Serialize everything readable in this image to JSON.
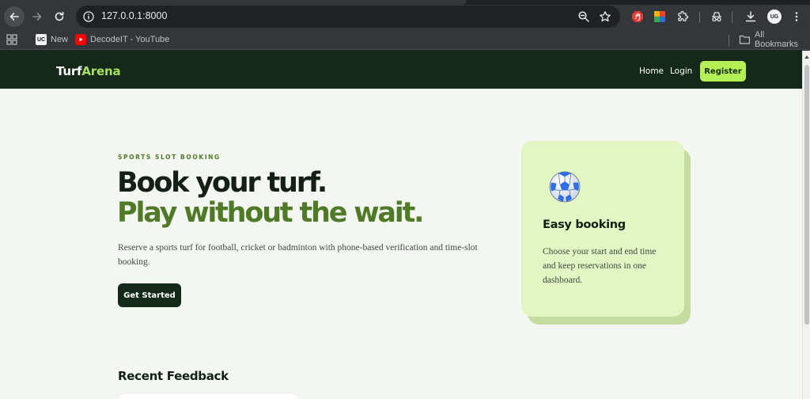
{
  "browser": {
    "url": "127.0.0.1:8000",
    "bookmarks": [
      {
        "label": "New",
        "icon": "uc-icon"
      },
      {
        "label": "DecodeIT - YouTube",
        "icon": "youtube-icon"
      }
    ],
    "all_bookmarks_label": "All Bookmarks",
    "profile_initials": "UG",
    "new_favicon_text": "UC"
  },
  "site": {
    "logo_part1": "Turf",
    "logo_part2": "Arena",
    "nav": {
      "home": "Home",
      "login": "Login",
      "register": "Register"
    }
  },
  "hero": {
    "eyebrow": "SPORTS SLOT BOOKING",
    "headline_line1": "Book your turf.",
    "headline_line2": "Play without the wait.",
    "description": "Reserve a sports turf for football, cricket or badminton with phone-based verification and time-slot booking.",
    "cta": "Get Started"
  },
  "feature_card": {
    "icon": "soccer-ball-icon",
    "title": "Easy booking",
    "body": "Choose your start and end time and keep reservations in one dashboard."
  },
  "feedback": {
    "title": "Recent Feedback"
  },
  "colors": {
    "nav_bg": "#14291a",
    "accent": "#b3ef55",
    "headline_green": "#4f7a28",
    "card_bg": "#e2f5c2",
    "page_bg": "#f4f6f1"
  }
}
